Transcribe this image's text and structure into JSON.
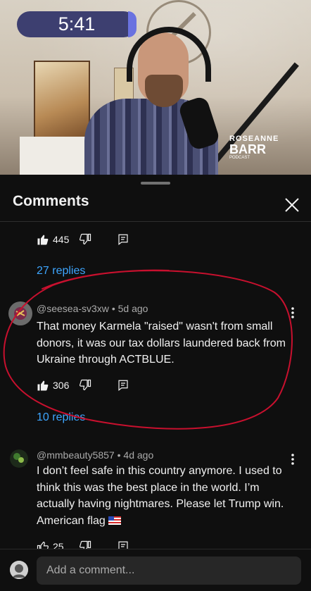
{
  "video": {
    "time": "5:41",
    "logo": {
      "line1": "ROSEANNE",
      "line2": "BARR",
      "line3": "PODCAST"
    }
  },
  "sheet": {
    "title": "Comments",
    "add_comment_placeholder": "Add a comment..."
  },
  "comments": [
    {
      "likes": "445",
      "replies": "27 replies"
    },
    {
      "handle": "@seesea-sv3xw",
      "age": "5d ago",
      "text": "That money Karmela \"raised\" wasn't from small donors, it was our tax dollars laundered back from Ukraine through ACTBLUE.",
      "likes": "306",
      "replies": "10 replies"
    },
    {
      "handle": "@mmbeauty5857",
      "age": "4d ago",
      "text": "I don’t feel safe in this country anymore. I used to think this was the best place in the world. I’m actually having nightmares. Please let Trump win. American flag",
      "likes": "25"
    }
  ],
  "colors": {
    "background": "#0f0f0f",
    "link": "#3ea6ff",
    "annotation": "#c8102e"
  },
  "icons": [
    "thumbs-up-icon",
    "thumbs-down-icon",
    "reply-icon",
    "more-vert-icon",
    "close-icon",
    "us-flag-icon"
  ]
}
